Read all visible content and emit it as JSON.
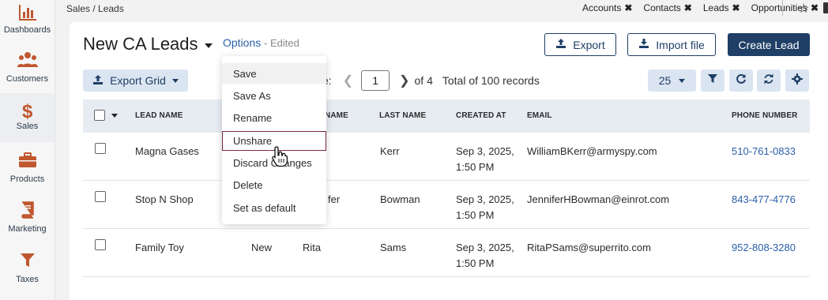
{
  "sidebar": {
    "items": [
      {
        "label": "Dashboards",
        "icon": "bar-chart-icon"
      },
      {
        "label": "Customers",
        "icon": "users-icon"
      },
      {
        "label": "Sales",
        "icon": "dollar-icon"
      },
      {
        "label": "Products",
        "icon": "briefcase-icon"
      },
      {
        "label": "Marketing",
        "icon": "book-icon"
      },
      {
        "label": "Taxes",
        "icon": "funnel-icon"
      }
    ]
  },
  "topbar": {
    "breadcrumb": "Sales / Leads",
    "quick_tabs": [
      "Accounts",
      "Contacts",
      "Leads",
      "Opportunities"
    ],
    "close_glyph": "✖"
  },
  "header": {
    "title": "New CA Leads",
    "options_label": "Options",
    "edited_label": "- Edited",
    "export_label": "Export",
    "import_label": "Import file",
    "create_label": "Create Lead"
  },
  "toolbar": {
    "export_grid_label": "Export Grid",
    "page_suffix": "e:",
    "page_value": "1",
    "of_label": "of 4",
    "total_label": "Total of 100 records",
    "page_size": "25"
  },
  "table": {
    "columns": [
      "LEAD NAME",
      "NAME",
      "LAST NAME",
      "CREATED AT",
      "EMAIL",
      "PHONE NUMBER"
    ],
    "rows": [
      {
        "lead_name": "Magna Gases",
        "status": "",
        "first_name": "m",
        "last_name": "Kerr",
        "created_line1": "Sep 3, 2025,",
        "created_line2": "1:50 PM",
        "email": "WilliamBKerr@armyspy.com",
        "phone": "510-761-0833"
      },
      {
        "lead_name": "Stop N Shop",
        "status": "",
        "first_name": "fer",
        "last_name": "Bowman",
        "created_line1": "Sep 3, 2025,",
        "created_line2": "1:50 PM",
        "email": "JenniferHBowman@einrot.com",
        "phone": "843-477-4776"
      },
      {
        "lead_name": "Family Toy",
        "status": "New",
        "first_name": "Rita",
        "last_name": "Sams",
        "created_line1": "Sep 3, 2025,",
        "created_line2": "1:50 PM",
        "email": "RitaPSams@superrito.com",
        "phone": "952-808-3280"
      }
    ]
  },
  "options_menu": {
    "items": [
      "Save",
      "Save As",
      "Rename",
      "Unshare",
      "Discard Changes",
      "Delete",
      "Set as default"
    ]
  },
  "colors": {
    "primary": "#1f3f66",
    "accent_light": "#dbe5f1",
    "link": "#2a5fa8",
    "focus_border": "#7a2846"
  }
}
